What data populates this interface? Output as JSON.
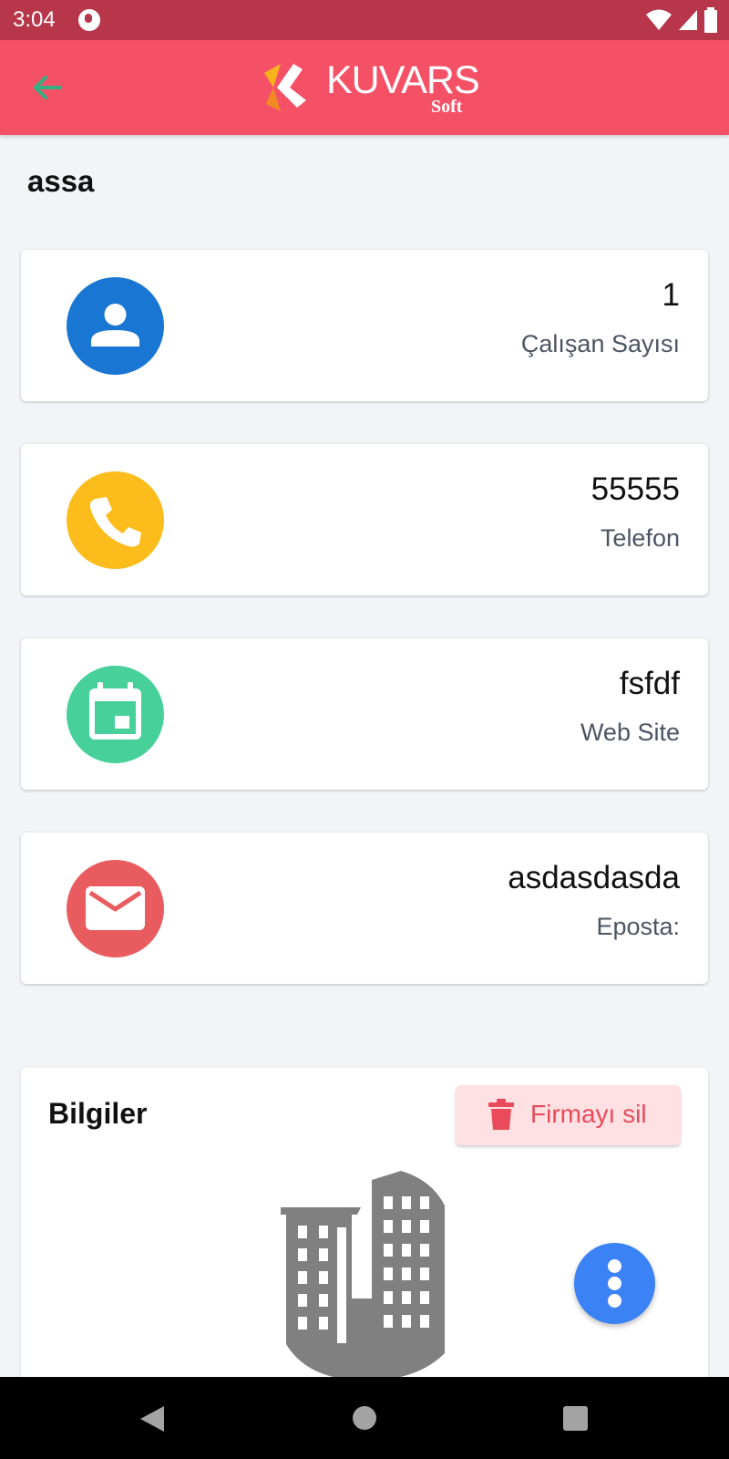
{
  "status_bar": {
    "time": "3:04",
    "icons": [
      "app-notification-icon",
      "wifi-icon",
      "signal-icon",
      "battery-icon"
    ]
  },
  "app_bar": {
    "logo_text": "KUVARS",
    "logo_subtext": "Soft",
    "back_icon": "arrow-left-icon",
    "background": "#f55166",
    "back_color": "#34b082"
  },
  "company": {
    "name": "assa"
  },
  "cards": [
    {
      "value": "1",
      "label": "Çalışan Sayısı",
      "icon": "person-icon",
      "color": "#1976d2"
    },
    {
      "value": "55555",
      "label": "Telefon",
      "icon": "phone-icon",
      "color": "#fbbc1c"
    },
    {
      "value": "fsfdf",
      "label": "Web Site",
      "icon": "calendar-icon",
      "color": "#48d09b"
    },
    {
      "value": "asdasdasda",
      "label": "Eposta:",
      "icon": "mail-icon",
      "color": "#e85c5f"
    }
  ],
  "info": {
    "title": "Bilgiler",
    "delete_label": "Firmayı sil",
    "delete_icon": "trash-icon",
    "image_icon": "building-icon"
  },
  "fab": {
    "icon": "more-vertical-icon",
    "color": "#3b82f6"
  },
  "nav_bar": {
    "icons": [
      "nav-back-icon",
      "nav-home-icon",
      "nav-recents-icon"
    ]
  }
}
